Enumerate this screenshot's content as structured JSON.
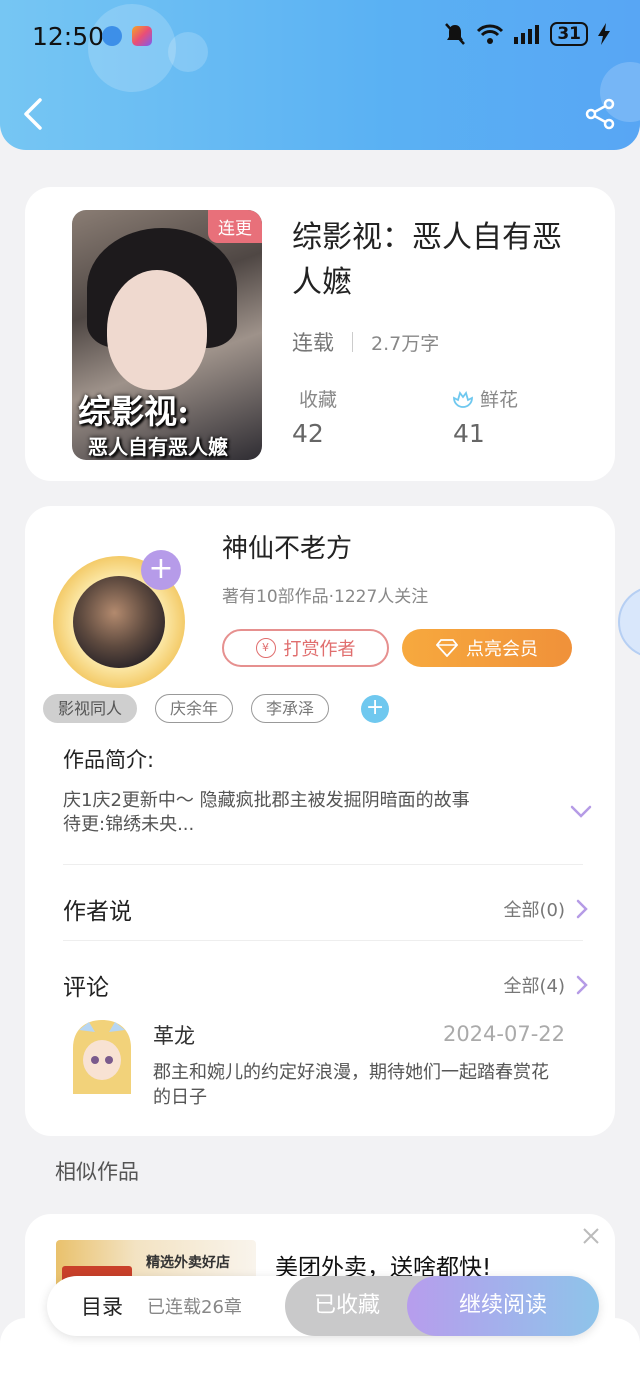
{
  "status_bar": {
    "time": "12:50",
    "battery": "31"
  },
  "book": {
    "badge": "连更",
    "cover_title_line1": "综影视:",
    "cover_title_line2": "恶人自有恶人嬷",
    "title": "综影视：恶人自有恶人嬷",
    "status": "连载",
    "word_count": "2.7万字",
    "collect_label": "收藏",
    "collect_count": "42",
    "flower_label": "鲜花",
    "flower_count": "41"
  },
  "author": {
    "name": "神仙不老方",
    "meta": "著有10部作品·1227人关注",
    "follow_symbol": "+",
    "reward_label": "打赏作者",
    "reward_coin": "¥",
    "vip_label": "点亮会员",
    "tags": [
      "影视同人",
      "庆余年",
      "李承泽"
    ],
    "tag_add": "+"
  },
  "intro": {
    "label": "作品简介:",
    "line1": "庆1庆2更新中～ 隐藏疯批郡主被发掘阴暗面的故事",
    "line2": "待更:锦绣未央..."
  },
  "author_says": {
    "label": "作者说",
    "more": "全部(0)"
  },
  "comments": {
    "label": "评论",
    "more": "全部(4)",
    "items": [
      {
        "user": "革龙",
        "date": "2024-07-22",
        "text": "郡主和婉儿的约定好浪漫，期待她们一起踏春赏花的日子"
      }
    ]
  },
  "similar": {
    "label": "相似作品"
  },
  "ad": {
    "image_text": "精选外卖好店",
    "title": "美团外卖，送啥都快!"
  },
  "bottom_bar": {
    "toc_label": "目录",
    "toc_progress": "已连载26章",
    "collected_label": "已收藏",
    "read_label": "继续阅读"
  }
}
